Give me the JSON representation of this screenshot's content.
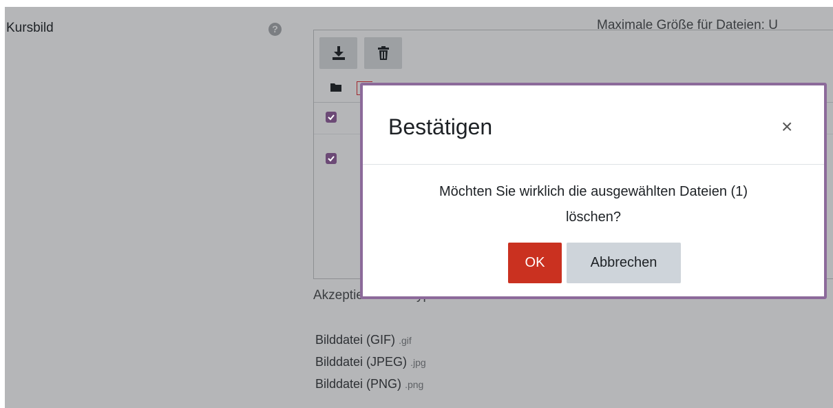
{
  "form": {
    "field_label": "Kursbild",
    "help_icon": "question-circle-icon",
    "max_size_text": "Maximale Größe für Dateien: U"
  },
  "filemanager": {
    "toolbar": {
      "download_icon": "download-icon",
      "delete_icon": "trash-icon"
    },
    "path_icon": "folder-icon",
    "rows_checked": [
      true,
      true
    ]
  },
  "accepted": {
    "title": "Akzeptierte Dateitypen:",
    "types": [
      {
        "label": "Bilddatei (GIF)",
        "ext": ".gif"
      },
      {
        "label": "Bilddatei (JPEG)",
        "ext": ".jpg"
      },
      {
        "label": "Bilddatei (PNG)",
        "ext": ".png"
      }
    ]
  },
  "modal": {
    "title": "Bestätigen",
    "close_glyph": "×",
    "message_line1": "Möchten Sie wirklich die ausgewählten Dateien (1)",
    "message_line2": "löschen?",
    "ok_label": "OK",
    "cancel_label": "Abbrechen"
  },
  "colors": {
    "backdrop": "#b5b6b8",
    "primary_danger": "#ca3120",
    "secondary_button": "#ced4da",
    "checkbox": "#6c4a76",
    "focus_border": "#8c6a9a"
  }
}
